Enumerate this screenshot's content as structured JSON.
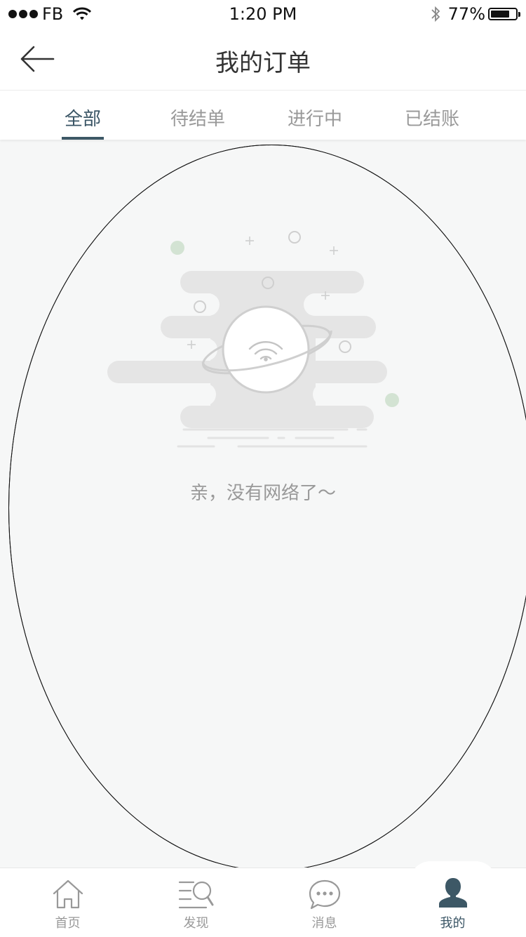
{
  "status_bar": {
    "carrier": "FB",
    "time": "1:20 PM",
    "battery_percent": "77%",
    "battery_level": 0.77,
    "signal_bars_filled": 3,
    "signal_bars_total": 5
  },
  "nav": {
    "title": "我的订单",
    "back_icon": "arrow-left-icon"
  },
  "tabs": [
    {
      "label": "全部",
      "active": true
    },
    {
      "label": "待结单",
      "active": false
    },
    {
      "label": "进行中",
      "active": false
    },
    {
      "label": "已结账",
      "active": false
    }
  ],
  "empty_state": {
    "illustration_icon": "no-network-planet-icon",
    "message": "亲，没有网络了～"
  },
  "tab_bar": [
    {
      "label": "首页",
      "icon": "home-icon",
      "active": false
    },
    {
      "label": "发现",
      "icon": "discover-icon",
      "active": false
    },
    {
      "label": "消息",
      "icon": "message-icon",
      "active": false
    },
    {
      "label": "我的",
      "icon": "person-icon",
      "active": true
    }
  ],
  "colors": {
    "accent": "#3d5866",
    "inactive_text": "#999999",
    "background": "#f6f7f7",
    "accent_green": "#d3e3d3"
  }
}
